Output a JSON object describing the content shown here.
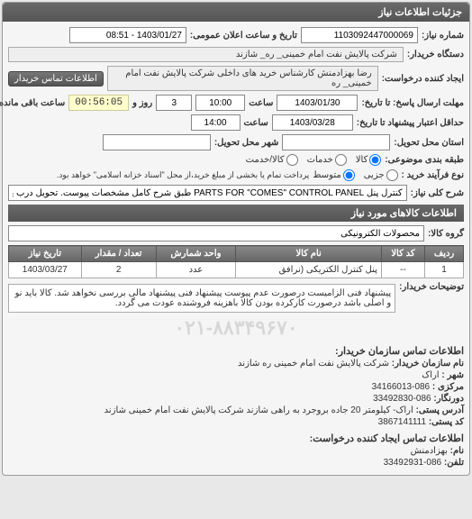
{
  "header": {
    "title": "جزئیات اطلاعات نیاز"
  },
  "fields": {
    "req_no_label": "شماره نیاز:",
    "req_no": "1103092447000069",
    "announce_label": "تاریخ و ساعت اعلان عمومی:",
    "announce_value": "1403/01/27 - 08:51",
    "buyer_org_label": "دستگاه خریدار:",
    "buyer_org": "شرکت پالایش نفت امام خمینی_ ره_ شازند",
    "creator_label": "ایجاد کننده درخواست:",
    "creator": "رضا بهزادمنش کارشناس خرید های داخلی   شرکت پالایش نفت امام خمینی_ ره",
    "contact_btn": "اطلاعات تماس خریدار",
    "deadline_label": "مهلت ارسال پاسخ: تا تاریخ:",
    "deadline_date": "1403/01/30",
    "time_label": "ساعت",
    "deadline_time": "10:00",
    "remain_days": "3",
    "remain_days_label": "روز و",
    "remain_time": "00:56:05",
    "remain_suffix": "ساعت باقی مانده",
    "validity_label": "حداقل اعتبار پیشنهاد تا تاریخ:",
    "validity_date": "1403/03/28",
    "validity_time": "14:00",
    "delivery_prov_label": "استان محل تحویل:",
    "delivery_city_label": "شهر محل تحویل:",
    "pack_label": "طبقه بندی موضوعی:",
    "pack_kala": "کالا",
    "pack_khadamat": "خدمات",
    "pack_both": "کالا/خدمت",
    "process_label": "نوع فرآیند خرید :",
    "process_small": "جزیی",
    "process_medium": "متوسط",
    "process_note": "پرداخت تمام یا بخشی از مبلغ خرید،از محل \"اسناد خزانه اسلامی\" خواهد بود.",
    "desc_label": "شرح کلی نیاز:",
    "desc_value": "کنترل پنل PARTS FOR \"COMES\" CONTROL PANEL طبق شرح کامل مشخصات پیوست. تحویل درب پالایشگاه."
  },
  "items_section": {
    "title": "اطلاعات کالاهای مورد نیاز",
    "group_label": "گروه کالا:",
    "group_value": "محصولات الکترونیکی",
    "cols": {
      "row": "ردیف",
      "code": "کد کالا",
      "name": "نام کالا",
      "unit": "واحد شمارش",
      "qty": "تعداد / مقدار",
      "need_date": "تاریخ نیاز"
    },
    "rows": [
      {
        "row": "1",
        "code": "--",
        "name": "پنل کنترل الکتریکی (نرافق",
        "unit": "عدد",
        "qty": "2",
        "need_date": "1403/03/27"
      }
    ]
  },
  "note": {
    "label": "توضیحات خریدار:",
    "text": "پیشنهاد فنی الزامیست درصورت عدم پیوست پیشنهاد فنی پیشنهاد مالی بررسی نخواهد شد. کالا باید نو و اصلی باشد درصورت کارکرده بودن کالا باهزینه فروشنده عودت می گردد."
  },
  "contact": {
    "title": "اطلاعات تماس سازمان خریدار:",
    "org_label": "نام سازمان خریدار:",
    "org": "شرکت پالایش نفت امام خمینی ره شازند",
    "city_label": "شهر :",
    "city": "اراک",
    "center_label": "مرکزی :",
    "phone_label": "086-34166013",
    "fax_label": "دورنگار:",
    "fax": "086-33492830",
    "addr_label": "آدرس پستی:",
    "addr": "اراک- کیلومتر 20 جاده بروجرد به راهی شازند شرکت پالایش نفت امام خمینی شازند",
    "post_label": "کد پستی:",
    "post": "3867141111",
    "req_contact_title": "اطلاعات تماس ایجاد کننده درخواست:",
    "person_label": "نام:",
    "person": "بهزادمنش",
    "tel_label": "تلفن:",
    "tel": "086-33492931"
  },
  "watermark": "۰۲۱-۸۸۳۴۹۶۷۰"
}
